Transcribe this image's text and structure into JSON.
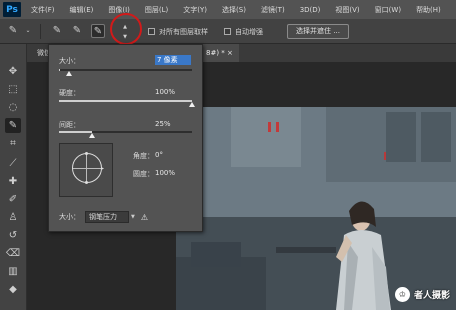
{
  "app": {
    "logo": "Ps"
  },
  "menu": [
    "文件(F)",
    "编辑(E)",
    "图像(I)",
    "图层(L)",
    "文字(Y)",
    "选择(S)",
    "滤镜(T)",
    "3D(D)",
    "视图(V)",
    "窗口(W)",
    "帮助(H)"
  ],
  "options_bar": {
    "sample_all_layers_label": "对所有图层取样",
    "auto_enhance_label": "自动增强",
    "select_and_mask_label": "选择并遮住 ...",
    "stepper_up": "▲",
    "stepper_down": "▼"
  },
  "tabs": {
    "tab1": "微信",
    "tab2": "8#) * ×"
  },
  "brush_panel": {
    "size_label": "大小：",
    "size_value": "7 像素",
    "hardness_label": "硬度：",
    "hardness_value": "100%",
    "hardness_level": 1.0,
    "spacing_label": "间距：",
    "spacing_value": "25%",
    "spacing_level": 0.25,
    "angle_label": "角度：",
    "angle_value": "0°",
    "roundness_label": "圆度：",
    "roundness_value": "100%",
    "bottom_size_label": "大小：",
    "pressure_option": "钢笔压力",
    "warning_icon": "⚠"
  },
  "watermark": {
    "badge": "♔",
    "text": "者人摄影"
  },
  "colors": {
    "accent": "#3a78c8",
    "highlight_circle": "#d11a1a"
  }
}
